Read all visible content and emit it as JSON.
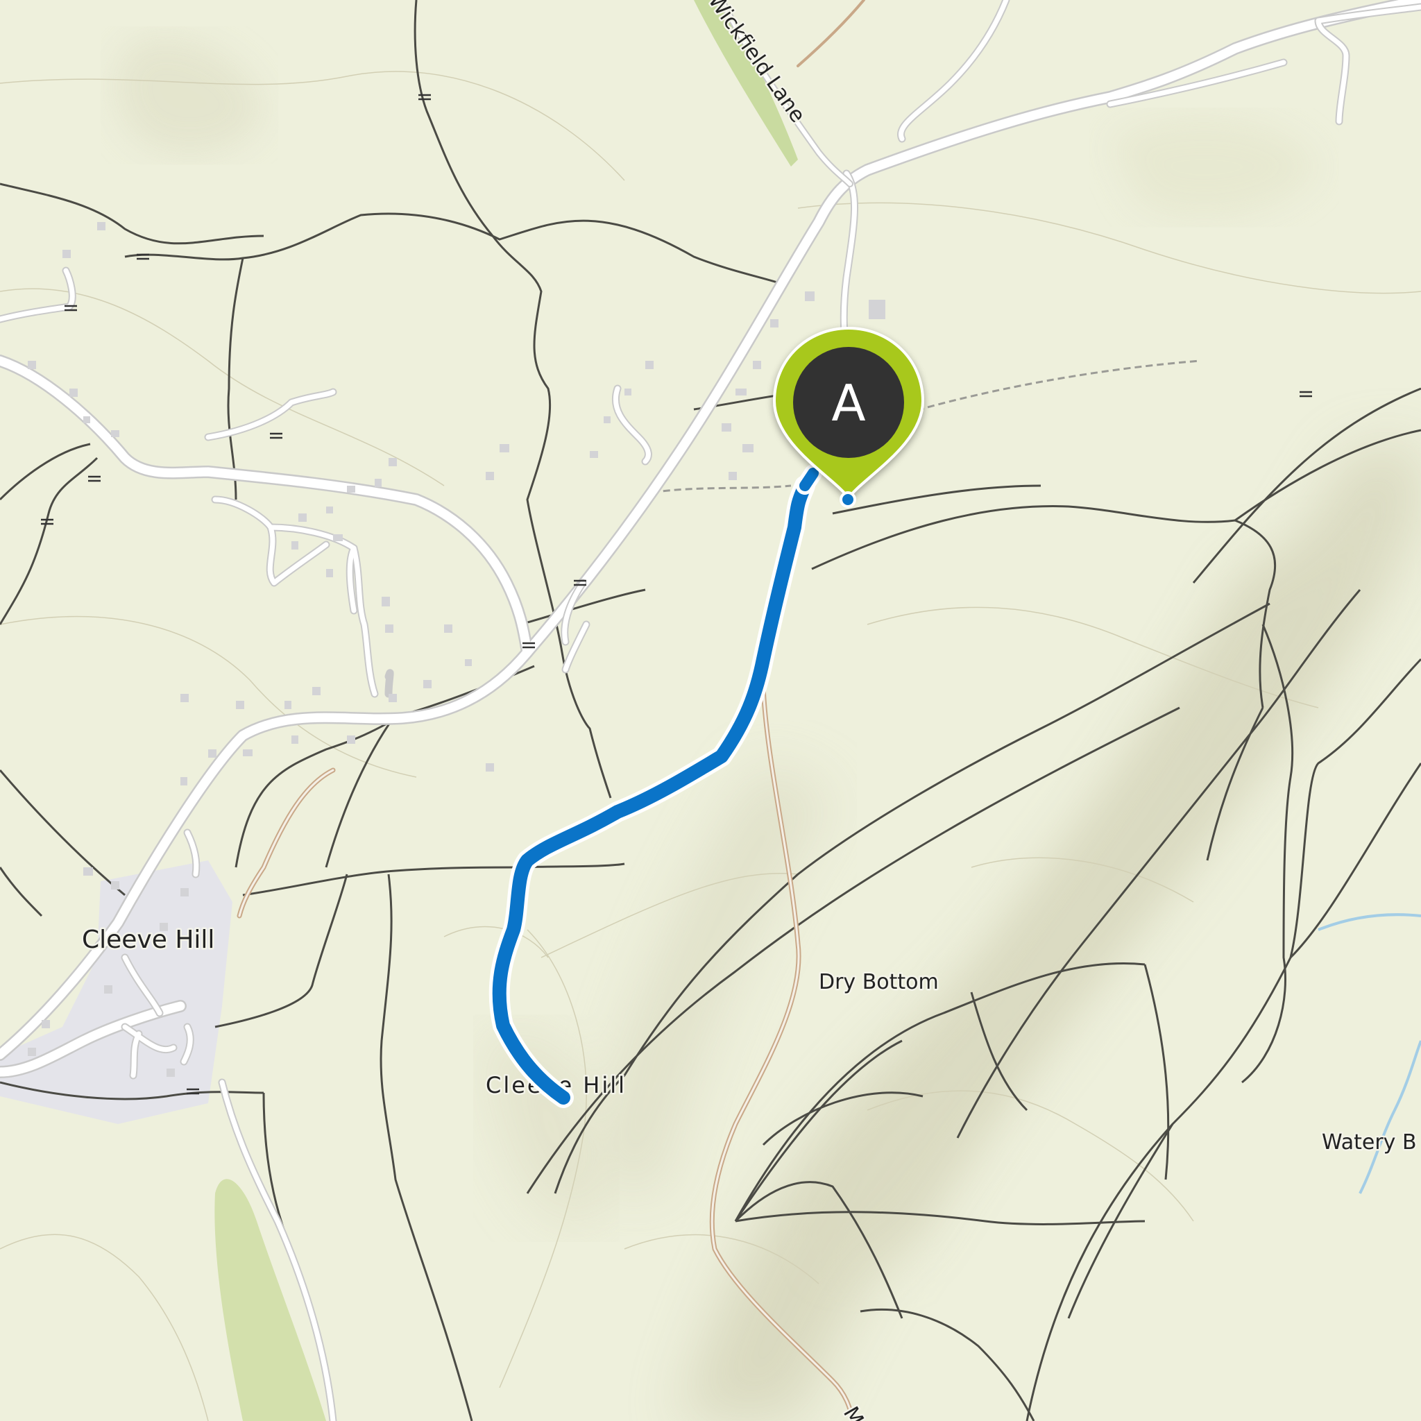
{
  "map": {
    "place_labels": {
      "village": "Cleeve Hill",
      "hill": "Cleeve Hill",
      "valley": "Dry Bottom",
      "stream_area": "Watery B",
      "road": "Wickfield Lane",
      "cut_off": "M"
    },
    "marker": {
      "label": "A",
      "color": "#a8c81e"
    },
    "route": {
      "color": "#0a74c8"
    }
  }
}
